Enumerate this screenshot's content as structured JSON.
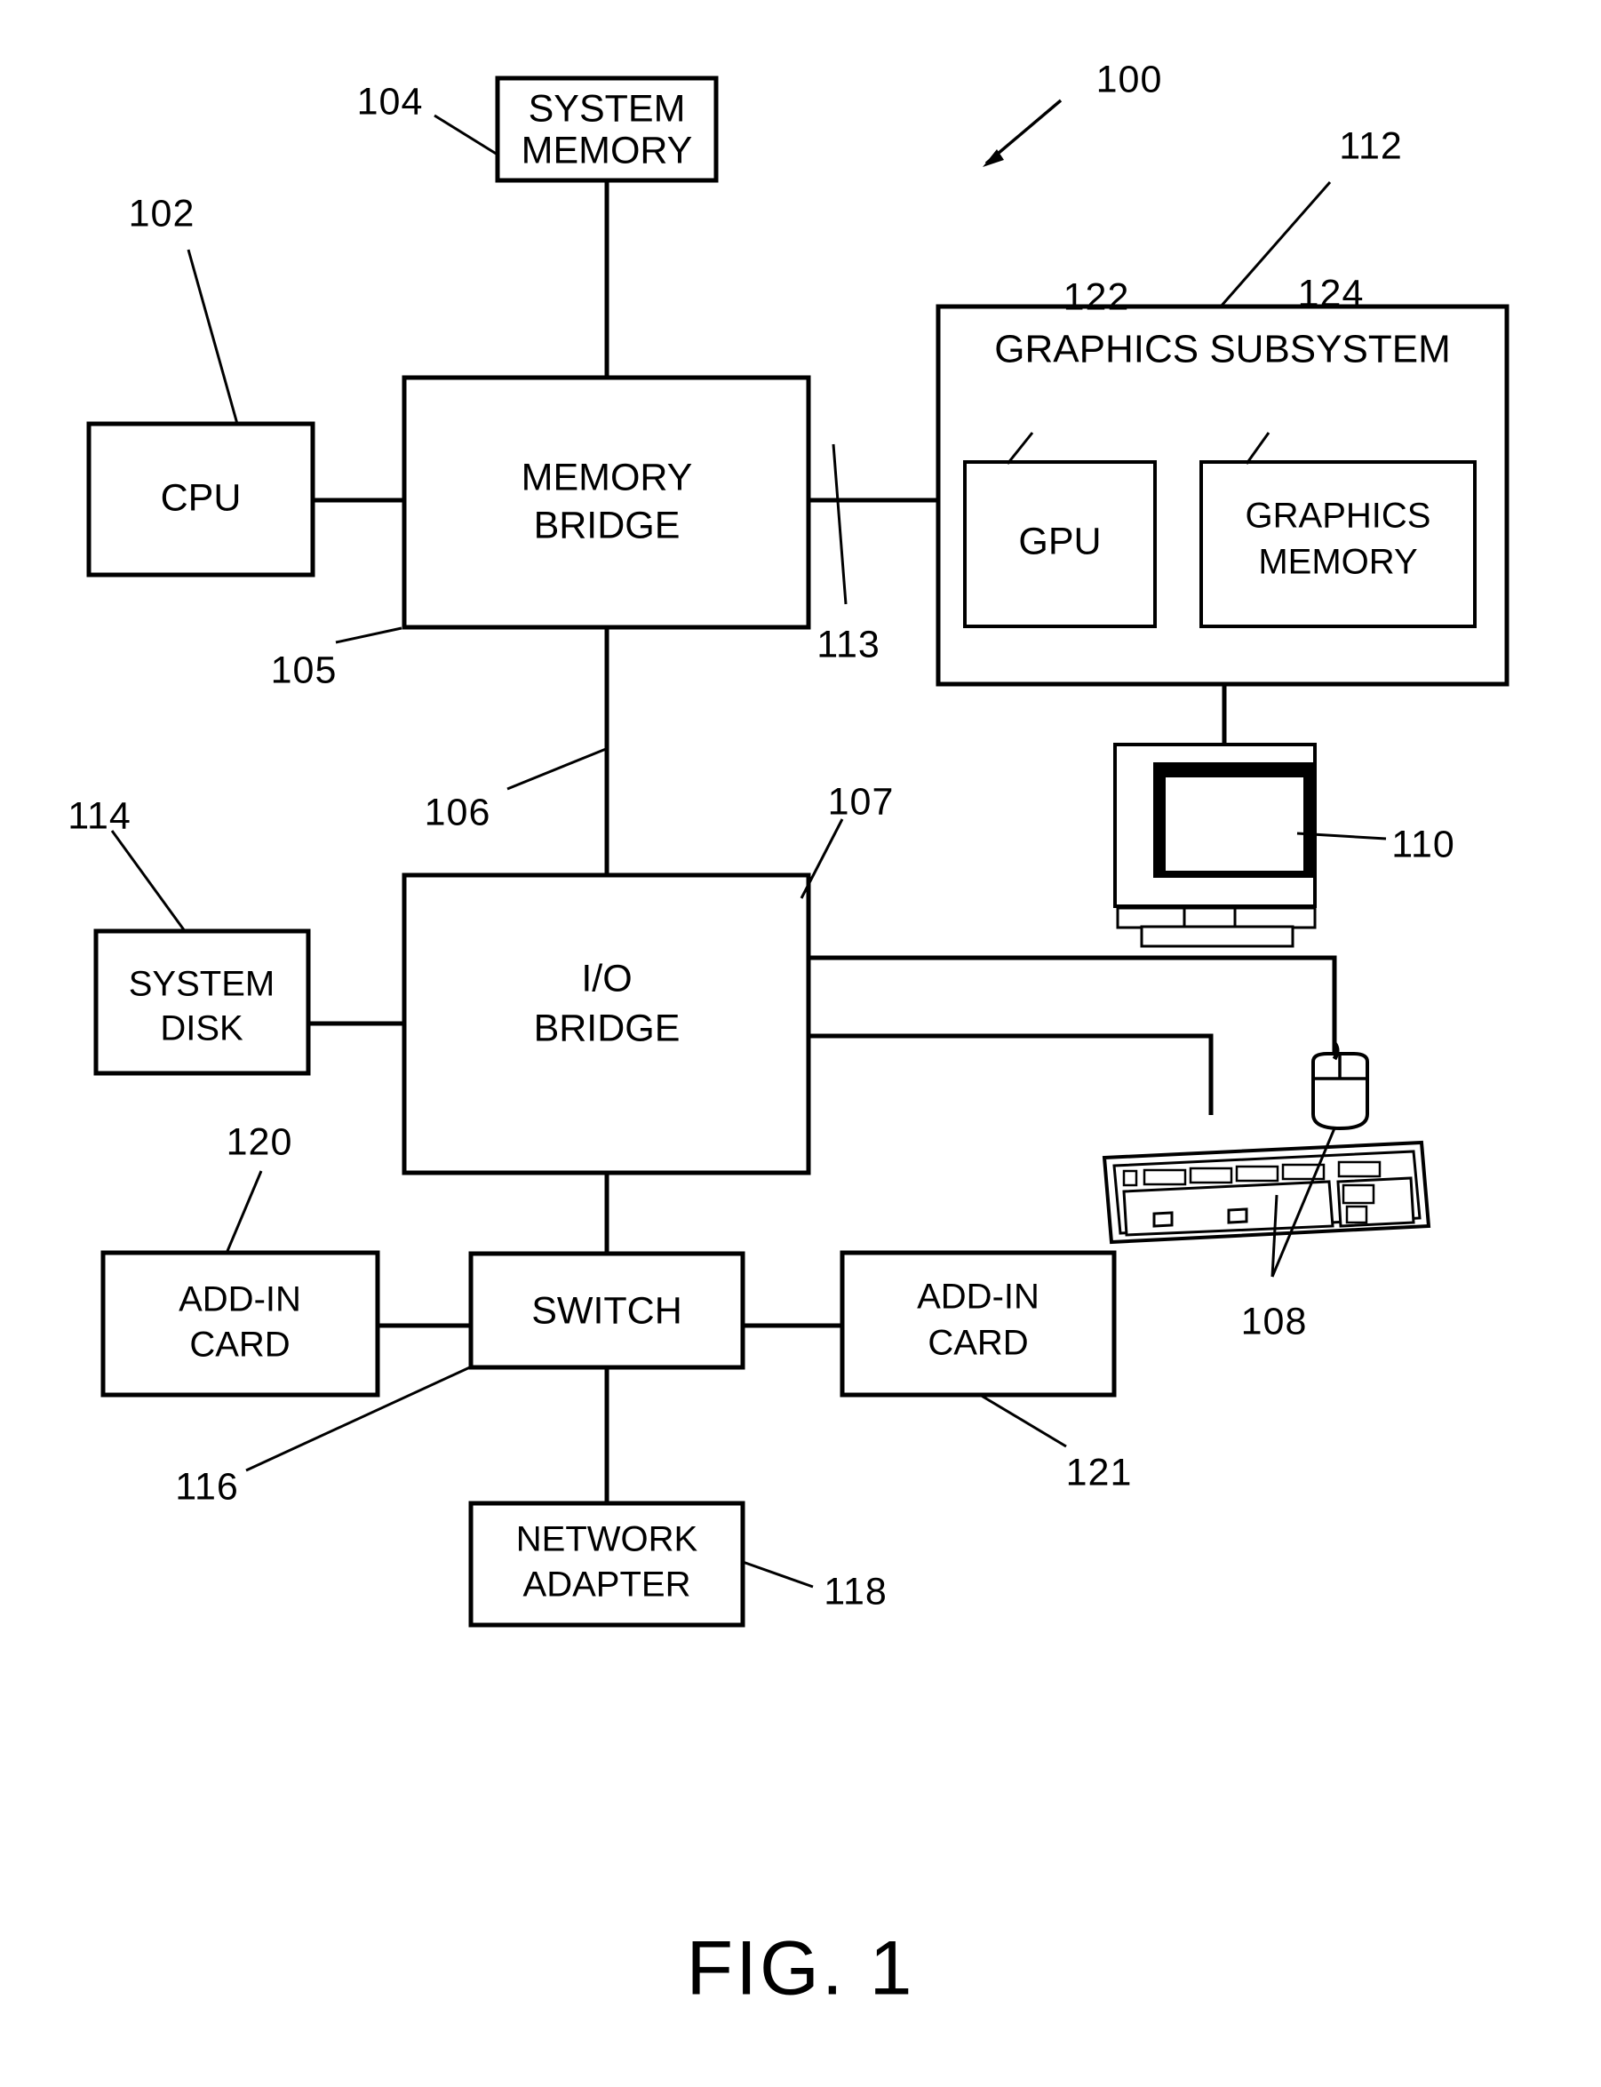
{
  "figure": {
    "caption": "FIG. 1",
    "system_ref": "100"
  },
  "blocks": {
    "cpu": {
      "label": "CPU",
      "ref": "102"
    },
    "system_memory": {
      "line1": "SYSTEM",
      "line2": "MEMORY",
      "ref": "104"
    },
    "memory_bridge": {
      "line1": "MEMORY",
      "line2": "BRIDGE",
      "ref": "105"
    },
    "io_bridge": {
      "line1": "I/O",
      "line2": "BRIDGE",
      "ref": "107"
    },
    "system_disk": {
      "line1": "SYSTEM",
      "line2": "DISK",
      "ref": "114"
    },
    "graphics_subsystem": {
      "label": "GRAPHICS SUBSYSTEM",
      "ref": "112"
    },
    "gpu": {
      "label": "GPU",
      "ref": "122"
    },
    "graphics_memory": {
      "line1": "GRAPHICS",
      "line2": "MEMORY",
      "ref": "124"
    },
    "switch": {
      "label": "SWITCH",
      "ref": "116"
    },
    "add_in_card_left": {
      "line1": "ADD-IN",
      "line2": "CARD",
      "ref": "120"
    },
    "add_in_card_right": {
      "line1": "ADD-IN",
      "line2": "CARD",
      "ref": "121"
    },
    "network_adapter": {
      "line1": "NETWORK",
      "line2": "ADAPTER",
      "ref": "118"
    }
  },
  "devices": {
    "display": {
      "name": "display-device",
      "ref": "110"
    },
    "input_devices": {
      "name": "keyboard-and-mouse",
      "ref": "108"
    }
  },
  "connections": {
    "cpu_to_memory_bridge": {
      "ref": ""
    },
    "memory_bridge_to_graphics": {
      "ref": "113"
    },
    "memory_bridge_to_io_bridge": {
      "ref": "106"
    }
  },
  "refs": {
    "r100": "100",
    "r102": "102",
    "r104": "104",
    "r105": "105",
    "r106a": "106",
    "r106b": "106",
    "r107": "107",
    "r108": "108",
    "r110": "110",
    "r112": "112",
    "r113": "113",
    "r114": "114",
    "r116": "116",
    "r118": "118",
    "r120": "120",
    "r121": "121",
    "r122": "122",
    "r124": "124"
  },
  "colors": {
    "ink": "#000000",
    "paper": "#ffffff"
  }
}
